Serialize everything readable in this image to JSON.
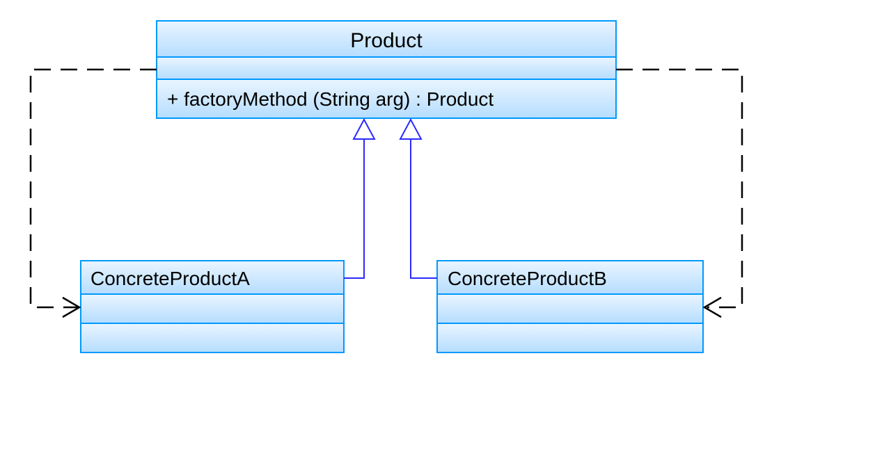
{
  "classes": {
    "product": {
      "name": "Product",
      "method": "+  factoryMethod (String arg) : Product"
    },
    "concreteA": {
      "name": "ConcreteProductA"
    },
    "concreteB": {
      "name": "ConcreteProductB"
    }
  }
}
